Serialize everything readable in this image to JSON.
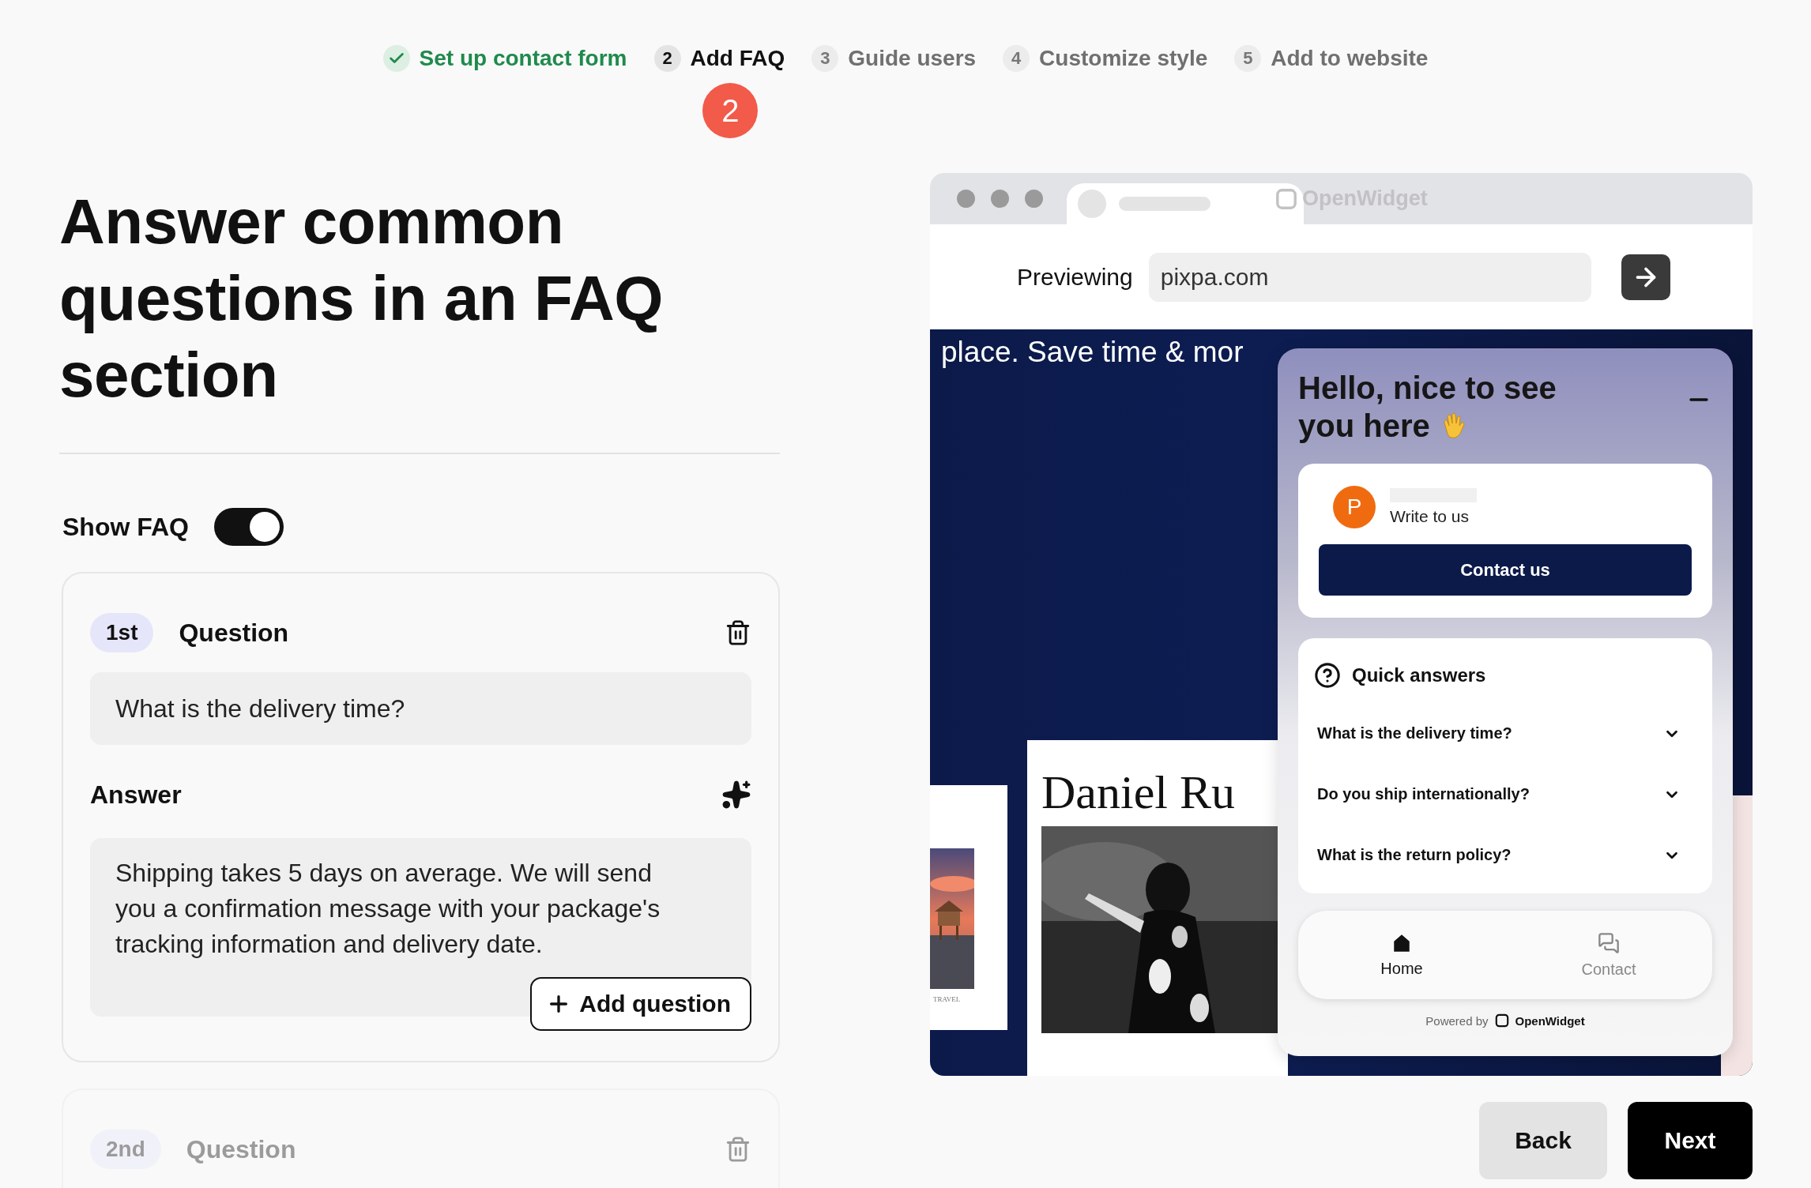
{
  "steps": [
    {
      "label": "Set up contact form",
      "done": true,
      "selected": false
    },
    {
      "number": "2",
      "label": "Add FAQ",
      "done": false,
      "selected": true,
      "callout": "2"
    },
    {
      "number": "3",
      "label": "Guide users",
      "done": false,
      "selected": false
    },
    {
      "number": "4",
      "label": "Customize style",
      "done": false,
      "selected": false
    },
    {
      "number": "5",
      "label": "Add to website",
      "done": false,
      "selected": false
    }
  ],
  "heading": "Answer common questions in an FAQ section",
  "show_faq": {
    "label": "Show FAQ",
    "on": true
  },
  "faq_items": [
    {
      "ordinal": "1st",
      "question_label": "Question",
      "question": "What is the delivery time?",
      "answer_label": "Answer",
      "answer": "Shipping takes 5 days on average. We will send you a confirmation message with your package's tracking information and delivery date.",
      "add_button": "Add question",
      "faded": false
    },
    {
      "ordinal": "2nd",
      "question_label": "Question",
      "faded": true
    }
  ],
  "preview": {
    "tab_title": "OpenWidget",
    "url_label": "Previewing",
    "url": "pixpa.com",
    "website": {
      "headline": "place. Save time & mor",
      "portfolio_title": "Daniel Ru",
      "card_caption": "TRAVEL"
    },
    "widget": {
      "greeting": "Hello, nice to see you here",
      "contact_card": {
        "subtitle": "Write to us",
        "avatar": "P",
        "button": "Contact us"
      },
      "quick_answers": {
        "title": "Quick answers",
        "questions": [
          "What is the delivery time?",
          "Do you ship internationally?",
          "What is the return policy?"
        ]
      },
      "nav": [
        {
          "kind": "home",
          "label": "Home",
          "selected": true
        },
        {
          "kind": "contact",
          "label": "Contact",
          "selected": false
        }
      ],
      "powered_by": "Powered by",
      "brand": "OpenWidget"
    }
  },
  "buttons": {
    "back": "Back",
    "next": "Next"
  }
}
